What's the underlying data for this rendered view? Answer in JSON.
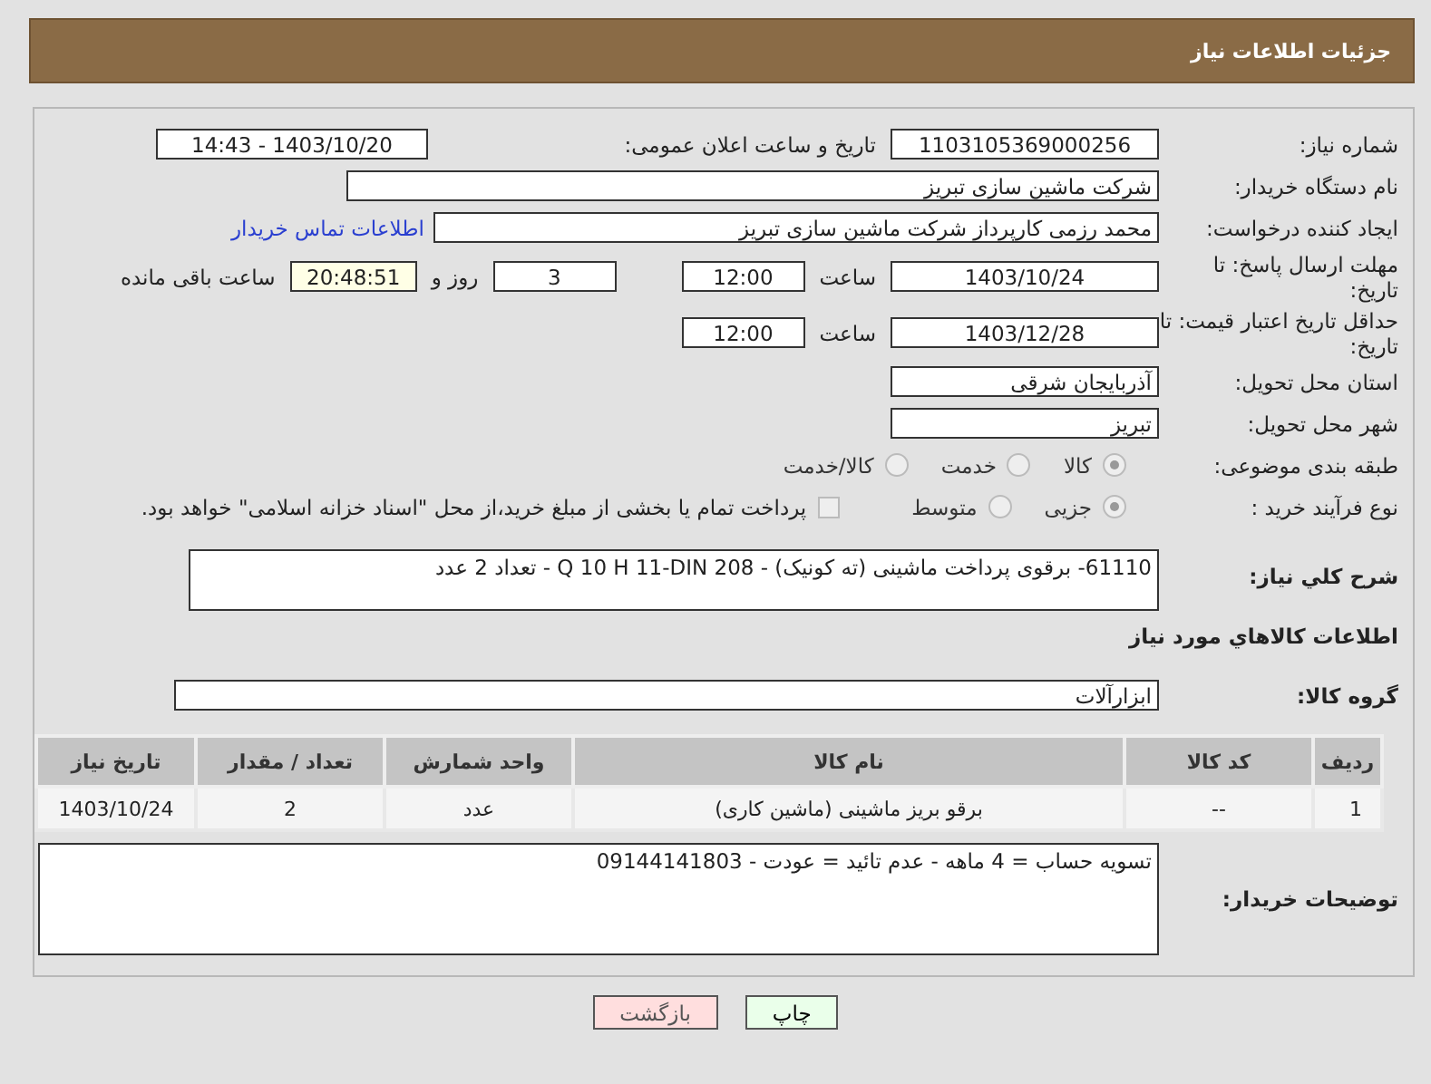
{
  "header": {
    "title": "جزئیات اطلاعات نیاز"
  },
  "fields": {
    "need_number_label": "شماره نیاز:",
    "need_number": "1103105369000256",
    "announce_label": "تاریخ و ساعت اعلان عمومی:",
    "announce": "1403/10/20 - 14:43",
    "buyer_label": "نام دستگاه خریدار:",
    "buyer": "شرکت ماشین سازی تبریز",
    "creator_label": "ایجاد کننده درخواست:",
    "creator": "محمد رزمی کارپرداز شرکت ماشین سازی تبریز",
    "contact_link": "اطلاعات تماس خریدار",
    "deadline_label": "مهلت ارسال پاسخ: تا تاریخ:",
    "deadline_date": "1403/10/24",
    "time_label": "ساعت",
    "deadline_time": "12:00",
    "days": "3",
    "days_label": "روز و",
    "remaining": "20:48:51",
    "remaining_label": "ساعت باقی مانده",
    "validity_label": "حداقل تاریخ اعتبار قیمت: تا تاریخ:",
    "validity_date": "1403/12/28",
    "validity_time_label": "ساعت",
    "validity_time": "12:00",
    "province_label": "استان محل تحویل:",
    "province": "آذربایجان شرقی",
    "city_label": "شهر محل تحویل:",
    "city": "تبریز"
  },
  "category": {
    "label": "طبقه بندی موضوعی:",
    "options": [
      {
        "label": "کالا",
        "selected": true
      },
      {
        "label": "خدمت",
        "selected": false
      },
      {
        "label": "کالا/خدمت",
        "selected": false
      }
    ]
  },
  "process": {
    "label": "نوع فرآیند خرید :",
    "options": [
      {
        "label": "جزیی",
        "selected": true
      },
      {
        "label": "متوسط",
        "selected": false
      }
    ],
    "treasury": {
      "label": "پرداخت تمام یا بخشی از مبلغ خرید،از محل \"اسناد خزانه اسلامی\" خواهد بود.",
      "checked": false
    }
  },
  "description": {
    "label": "شرح کلي نياز:",
    "value": "61110- برقوی پرداخت ماشینی (ته کونیک) -  Q 10 H 11-DIN 208 - تعداد 2 عدد"
  },
  "goods_heading": "اطلاعات کالاهاي مورد نياز",
  "goods_group": {
    "label": "گروه کالا:",
    "value": "ابزارآلات"
  },
  "table": {
    "columns": [
      "ردیف",
      "کد کالا",
      "نام کالا",
      "واحد شمارش",
      "تعداد / مقدار",
      "تاریخ نیاز"
    ],
    "rows": [
      [
        "1",
        "--",
        "برقو بریز ماشینی (ماشین کاری)",
        "عدد",
        "2",
        "1403/10/24"
      ]
    ]
  },
  "notes": {
    "label": "توضیحات خریدار:",
    "value": "تسویه حساب = 4 ماهه - عدم تائید = عودت - 09144141803"
  },
  "buttons": [
    {
      "label": "چاپ",
      "kind": "print"
    },
    {
      "label": "بازگشت",
      "kind": "back"
    }
  ]
}
